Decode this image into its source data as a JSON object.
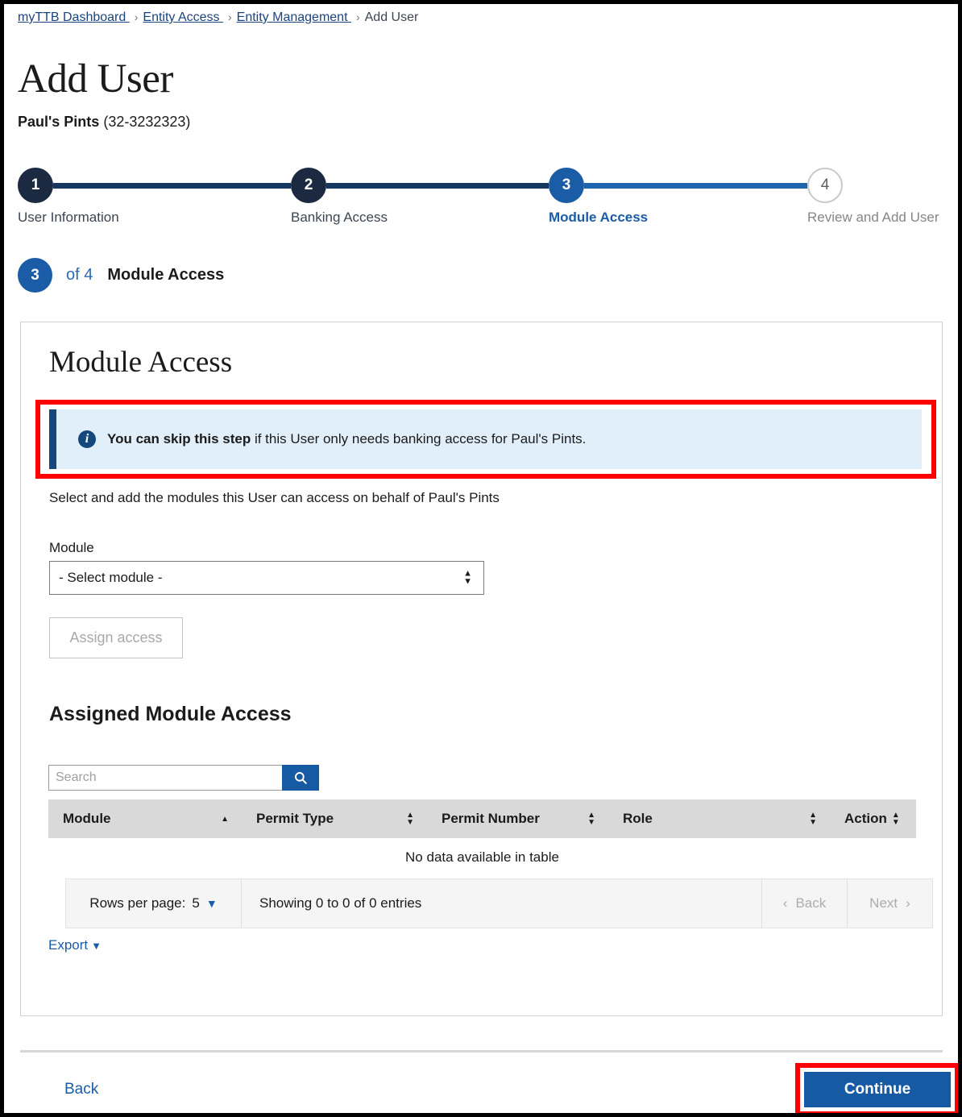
{
  "breadcrumb": {
    "items": [
      {
        "label": "myTTB Dashboard ",
        "link": true
      },
      {
        "label": "Entity Access ",
        "link": true
      },
      {
        "label": "Entity Management ",
        "link": true
      },
      {
        "label": "Add User",
        "link": false
      }
    ],
    "separator": "›"
  },
  "page": {
    "title": "Add User",
    "entity_name": "Paul's Pints",
    "entity_number": "(32-3232323)"
  },
  "stepper": {
    "steps": [
      {
        "number": "1",
        "label": "User Information",
        "state": "done"
      },
      {
        "number": "2",
        "label": "Banking Access",
        "state": "done"
      },
      {
        "number": "3",
        "label": "Module Access",
        "state": "active"
      },
      {
        "number": "4",
        "label": "Review and Add User",
        "state": "todo"
      }
    ]
  },
  "substep": {
    "number": "3",
    "of_text": "of 4",
    "name": "Module Access"
  },
  "card": {
    "title": "Module Access",
    "alert": {
      "icon": "info-icon",
      "bold_text": "You can skip this step",
      "rest_text": " if this User only needs banking access for Paul's Pints."
    },
    "helper_text": "Select and add the modules this User can access on behalf of Paul's Pints",
    "module_field": {
      "label": "Module",
      "selected": "- Select module -"
    },
    "assign_button": "Assign access",
    "assigned_section": {
      "title": "Assigned Module Access",
      "search_placeholder": "Search",
      "search_value": "",
      "search_icon": "search-icon",
      "columns": [
        {
          "label": "Module",
          "sort": "asc"
        },
        {
          "label": "Permit Type",
          "sort": "none"
        },
        {
          "label": "Permit Number",
          "sort": "none"
        },
        {
          "label": "Role",
          "sort": "none"
        },
        {
          "label": "Action",
          "sort": "none"
        }
      ],
      "rows": [],
      "empty_message": "No data available in table",
      "pagination": {
        "rows_per_page_label": "Rows per page:",
        "rows_per_page_value": "5",
        "showing_text": "Showing 0 to 0 of 0 entries",
        "back_label": "Back",
        "next_label": "Next"
      },
      "export_label": "Export"
    }
  },
  "footer": {
    "back_label": "Back",
    "continue_label": "Continue"
  },
  "colors": {
    "brand_blue": "#165aa3",
    "step_done": "#1b2a41",
    "step_active": "#1a5ca5",
    "alert_bg": "#e1effa",
    "alert_bar": "#14487c",
    "highlight_red": "#ff0000",
    "table_header_bg": "#d9d9d9"
  }
}
